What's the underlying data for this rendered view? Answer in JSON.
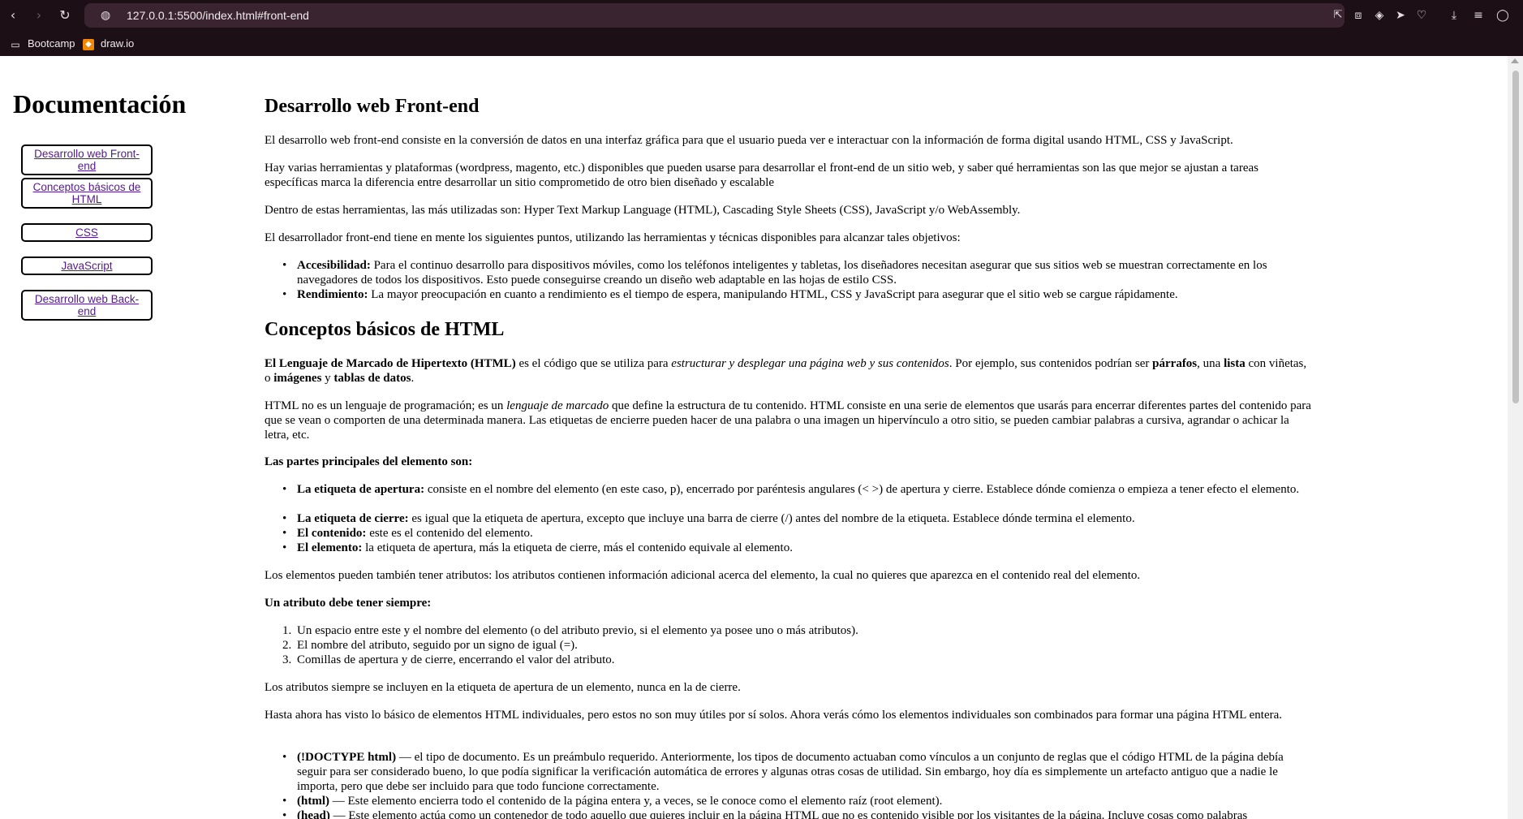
{
  "browser": {
    "url": "127.0.0.1:5500/index.html#front-end",
    "bookmarks": [
      "Bootcamp",
      "draw.io"
    ]
  },
  "sidebar": {
    "title": "Documentación",
    "links": [
      "Desarrollo web Front-end",
      "Conceptos básicos de HTML",
      "CSS",
      "JavaScript",
      "Desarrollo web Back-end"
    ]
  },
  "frontend": {
    "heading": "Desarrollo web Front-end",
    "p1": "El desarrollo web front-end consiste en la conversión de datos en una interfaz gráfica para que el usuario pueda ver e interactuar con la información de forma digital usando HTML, CSS y JavaScript.",
    "p2": "Hay varias herramientas y plataformas (wordpress, magento, etc.) disponibles que pueden usarse para desarrollar el front-end de un sitio web, y saber qué herramientas son las que mejor se ajustan a tareas específicas marca la diferencia entre desarrollar un sitio comprometido de otro bien diseñado y escalable",
    "p3": "Dentro de estas herramientas, las más utilizadas son: Hyper Text Markup Language (HTML), Cascading Style Sheets (CSS), JavaScript y/o WebAssembly.",
    "p4": "El desarrollador front-end tiene en mente los siguientes puntos, utilizando las herramientas y técnicas disponibles para alcanzar tales objetivos:",
    "li1_b": "Accesibilidad:",
    "li1": " Para el continuo desarrollo para dispositivos móviles, como los teléfonos inteligentes y tabletas, los diseñadores necesitan asegurar que sus sitios web se muestran correctamente en los navegadores de todos los dispositivos. Esto puede conseguirse creando un diseño web adaptable en las hojas de estilo CSS.",
    "li2_b": "Rendimiento:",
    "li2": " La mayor preocupación en cuanto a rendimiento es el tiempo de espera, manipulando HTML, CSS y JavaScript para asegurar que el sitio web se cargue rápidamente."
  },
  "html": {
    "heading": "Conceptos básicos de HTML",
    "p1": {
      "b1": "El Lenguaje de Marcado de Hipertexto (HTML)",
      "t1": " es el código que se utiliza para ",
      "i1": "estructurar y desplegar una página web y sus contenidos",
      "t2": ". Por ejemplo, sus contenidos podrían ser ",
      "b2": "párrafos",
      "t3": ", una ",
      "b3": "lista",
      "t4": " con viñetas, o ",
      "b4": "imágenes",
      "t5": " y ",
      "b5": "tablas de datos",
      "t6": "."
    },
    "p2": {
      "t1": "HTML no es un lenguaje de programación; es un ",
      "i1": "lenguaje de marcado",
      "t2": " que define la estructura de tu contenido. HTML consiste en una serie de elementos que usarás para encerrar diferentes partes del contenido para que se vean o comporten de una determinada manera. Las etiquetas de encierre pueden hacer de una palabra o una imagen un hipervínculo a otro sitio, se pueden cambiar palabras a cursiva, agrandar o achicar la letra, etc."
    },
    "parts_title": "Las partes principales del elemento son:",
    "parts": [
      {
        "b": "La etiqueta de apertura:",
        "t": " consiste en el nombre del elemento (en este caso, p), encerrado por paréntesis angulares (< >) de apertura y cierre. Establece dónde comienza o empieza a tener efecto el elemento."
      },
      {
        "b": "La etiqueta de cierre:",
        "t": " es igual que la etiqueta de apertura, excepto que incluye una barra de cierre (/) antes del nombre de la etiqueta. Establece dónde termina el elemento."
      },
      {
        "b": "El contenido:",
        "t": " este es el contenido del elemento."
      },
      {
        "b": "El elemento:",
        "t": " la etiqueta de apertura, más la etiqueta de cierre, más el contenido equivale al elemento."
      }
    ],
    "p3": "Los elementos pueden también tener atributos: los atributos contienen información adicional acerca del elemento, la cual no quieres que aparezca en el contenido real del elemento.",
    "attr_title": "Un atributo debe tener siempre:",
    "attrs": [
      "Un espacio entre este y el nombre del elemento (o del atributo previo, si el elemento ya posee uno o más atributos).",
      "El nombre del atributo, seguido por un signo de igual (=).",
      "Comillas de apertura y de cierre, encerrando el valor del atributo."
    ],
    "p4": "Los atributos siempre se incluyen en la etiqueta de apertura de un elemento, nunca en la de cierre.",
    "p5": "Hasta ahora has visto lo básico de elementos HTML individuales, pero estos no son muy útiles por sí solos. Ahora verás cómo los elementos individuales son combinados para formar una página HTML entera.",
    "doc": [
      {
        "b": "(!DOCTYPE html)",
        "t": " — el tipo de documento. Es un preámbulo requerido. Anteriormente, los tipos de documento actuaban como vínculos a un conjunto de reglas que el código HTML de la página debía seguir para ser considerado bueno, lo que podía significar la verificación automática de errores y algunas otras cosas de utilidad. Sin embargo, hoy día es simplemente un artefacto antiguo que a nadie le importa, pero que debe ser incluido para que todo funcione correctamente."
      },
      {
        "b": "(html)",
        "t": " — Este elemento encierra todo el contenido de la página entera y, a veces, se le conoce como el elemento raíz (root element)."
      },
      {
        "b": "(head)",
        "t": " — Este elemento actúa como un contenedor de todo aquello que quieres incluir en la página HTML que no es contenido visible por los visitantes de la página. Incluye cosas como palabras"
      }
    ]
  }
}
